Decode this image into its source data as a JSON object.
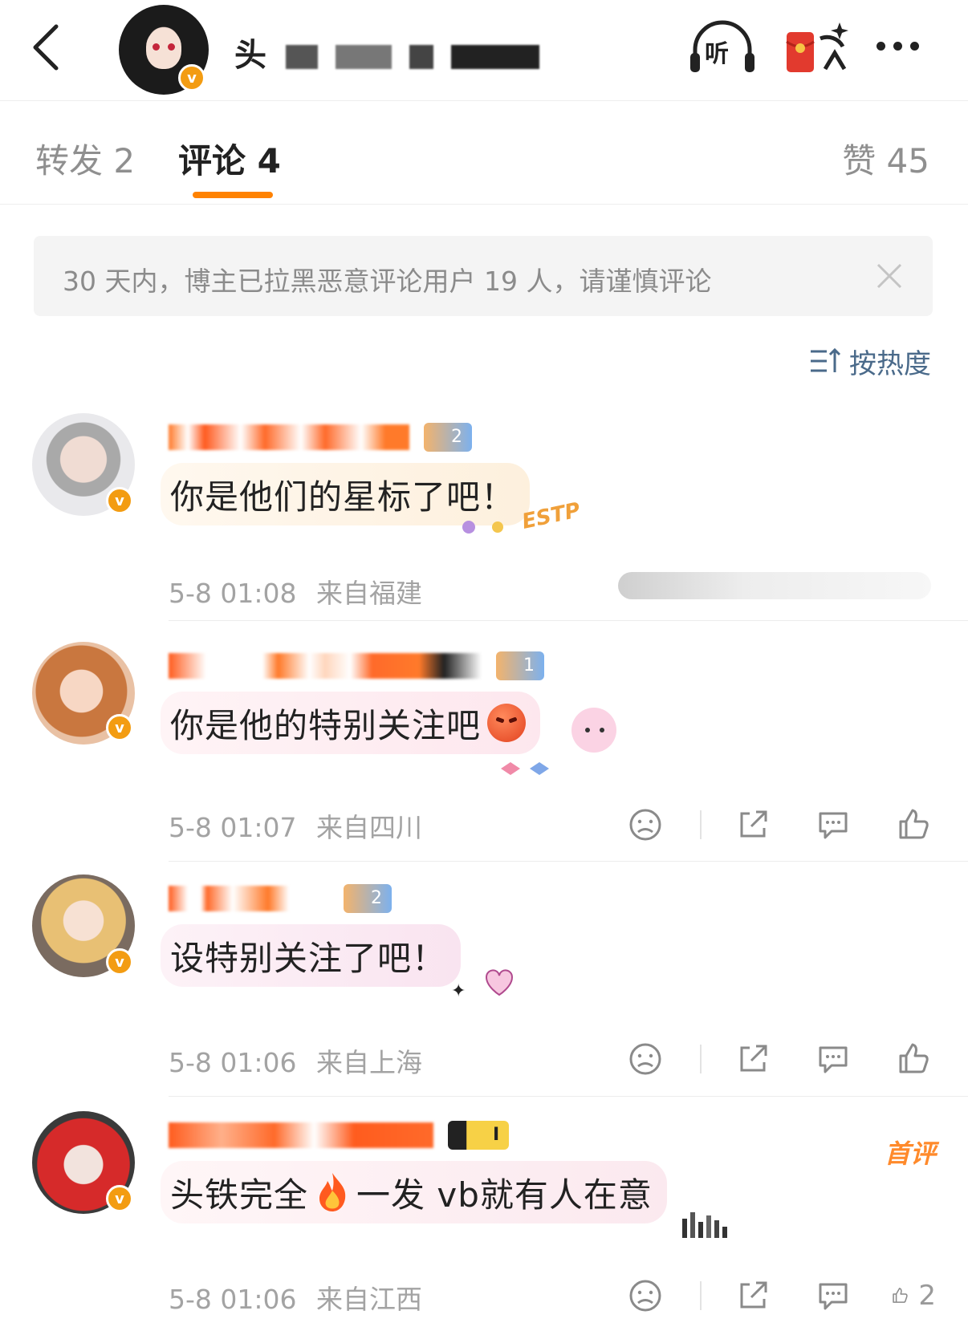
{
  "header": {
    "title_visible": "头",
    "listen_label": "听"
  },
  "tabs": {
    "repost": "转发 2",
    "comment": "评论 4",
    "likes": "赞 45"
  },
  "notice": {
    "text": "30 天内，博主已拉黑恶意评论用户 19 人，请谨慎评论"
  },
  "sort": {
    "label": "按热度"
  },
  "comments": [
    {
      "text": "你是他们的星标了吧！",
      "date": "5-8 01:08",
      "location": "来自福建",
      "first_comment": ""
    },
    {
      "text": "你是他的特别关注吧",
      "date": "5-8 01:07",
      "location": "来自四川",
      "first_comment": ""
    },
    {
      "text": "设特别关注了吧！",
      "date": "5-8 01:06",
      "location": "来自上海",
      "first_comment": ""
    },
    {
      "text_before": "头铁完全",
      "text_after": "一发 vb就有人在意",
      "date": "5-8 01:06",
      "location": "来自江西",
      "like_count": "2",
      "first_comment": "首评"
    }
  ],
  "badges": {
    "v": "v"
  },
  "colors": {
    "accent": "#ff8200",
    "verified": "#f39c12",
    "sort": "#4a6a8a"
  },
  "icons": [
    "back-icon",
    "headphones-icon",
    "red-packet-icon",
    "more-icon",
    "close-icon",
    "sort-icon",
    "dislike-icon",
    "share-icon",
    "comment-icon",
    "like-icon"
  ]
}
